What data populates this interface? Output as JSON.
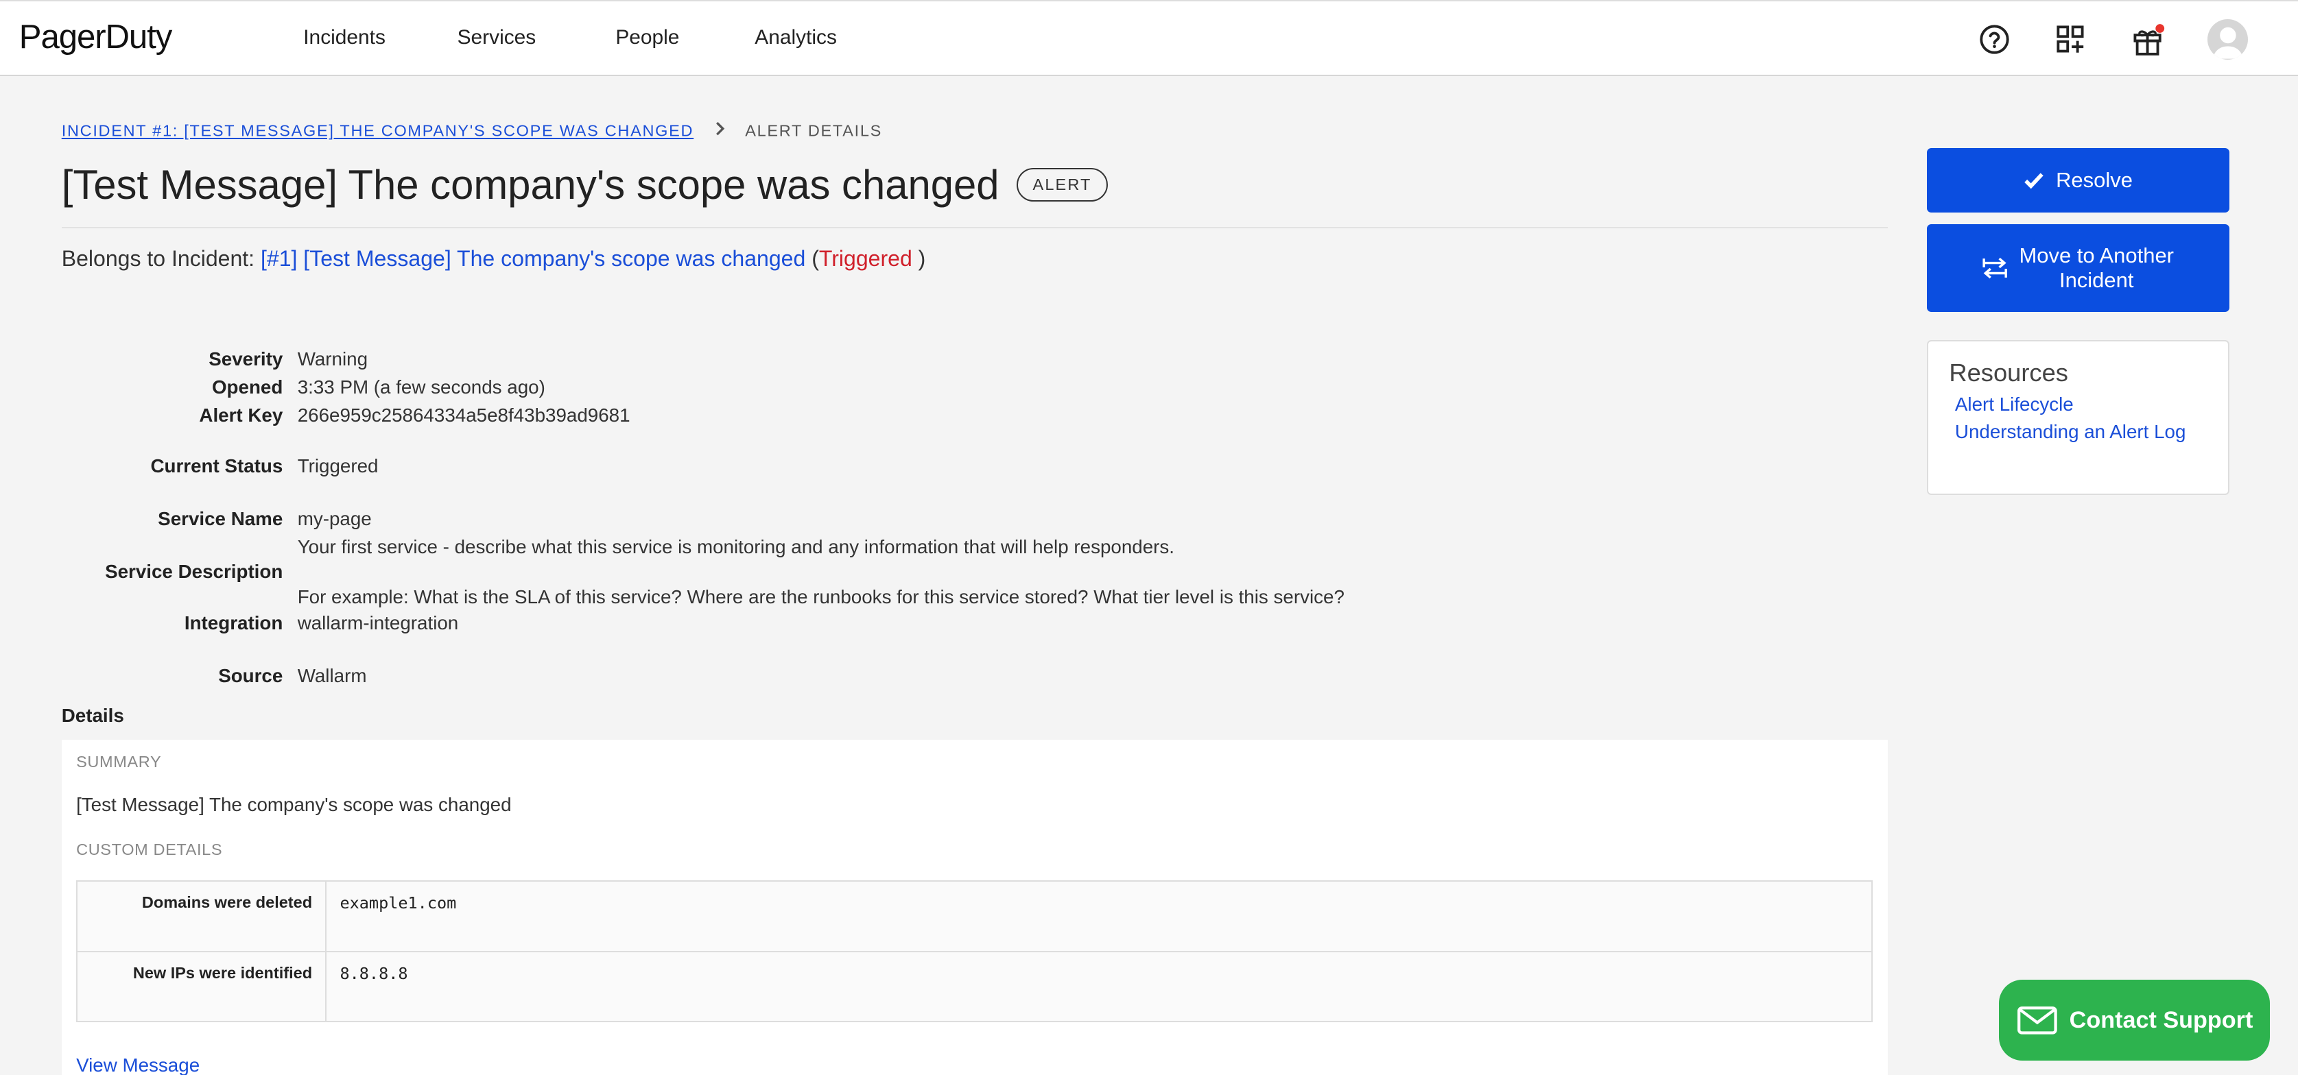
{
  "nav": {
    "logo": "PagerDuty",
    "links": [
      "Incidents",
      "Services",
      "People",
      "Analytics"
    ],
    "icons": [
      "help-icon",
      "apps-icon",
      "gift-icon",
      "avatar"
    ],
    "notification_color": "#e8352d"
  },
  "breadcrumb": {
    "incident_link": "INCIDENT #1: [TEST MESSAGE] THE COMPANY'S SCOPE WAS CHANGED",
    "current": "ALERT DETAILS"
  },
  "alert": {
    "title": "[Test Message] The company's scope was changed",
    "badge": "ALERT",
    "belongs_prefix": "Belongs to Incident:",
    "belongs_link": "[#1] [Test Message] The company's scope was changed",
    "paren_open": "(",
    "paren_close": ")",
    "belongs_status": "Triggered"
  },
  "props": {
    "severity_label": "Severity",
    "severity": "Warning",
    "opened_label": "Opened",
    "opened": "3:33 PM (a few seconds ago)",
    "alert_key_label": "Alert Key",
    "alert_key": "266e959c25864334a5e8f43b39ad9681",
    "status_label": "Current Status",
    "status": "Triggered",
    "service_name_label": "Service Name",
    "service_name": "my-page",
    "service_desc_line1": "Your first service - describe what this service is monitoring and any information that will help responders.",
    "service_desc_label": "Service Description",
    "service_desc_line2": "For example: What is the SLA of this service? Where are the runbooks for this service stored? What tier level is this service?",
    "integration_label": "Integration",
    "integration": "wallarm-integration",
    "source_label": "Source",
    "source": "Wallarm"
  },
  "details": {
    "label": "Details",
    "summary_label": "SUMMARY",
    "summary": "[Test Message] The company's scope was changed",
    "custom_label": "CUSTOM DETAILS",
    "rows": [
      {
        "key": "Domains were deleted",
        "value": "example1.com"
      },
      {
        "key": "New IPs were identified",
        "value": "8.8.8.8"
      }
    ],
    "view_message": "View Message"
  },
  "sidebar": {
    "resolve": "Resolve",
    "move_line1": "Move to Another",
    "move_line2": "Incident",
    "resources_title": "Resources",
    "links": [
      "Alert Lifecycle",
      "Understanding an Alert Log"
    ]
  },
  "contact_support": "Contact Support",
  "colors": {
    "primary": "#0b4ee0",
    "link": "#1a4ed8",
    "triggered": "#d0202b",
    "support": "#2db34e"
  }
}
